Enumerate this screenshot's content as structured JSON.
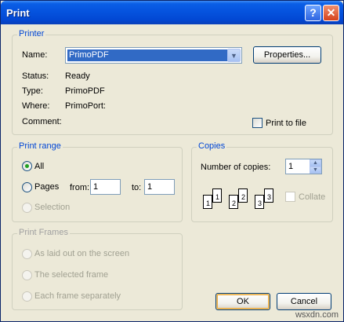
{
  "window": {
    "title": "Print",
    "help_symbol": "?",
    "close_symbol": "✕"
  },
  "printer": {
    "legend": "Printer",
    "name_label": "Name:",
    "name_value": "PrimoPDF",
    "properties_label": "Properties...",
    "status_label": "Status:",
    "status_value": "Ready",
    "type_label": "Type:",
    "type_value": "PrimoPDF",
    "where_label": "Where:",
    "where_value": "PrimoPort:",
    "comment_label": "Comment:",
    "print_to_file_label": "Print to file"
  },
  "print_range": {
    "legend": "Print range",
    "all_label": "All",
    "pages_label": "Pages",
    "from_label": "from:",
    "from_value": "1",
    "to_label": "to:",
    "to_value": "1",
    "selection_label": "Selection"
  },
  "copies": {
    "legend": "Copies",
    "number_label": "Number of copies:",
    "number_value": "1",
    "collate_label": "Collate",
    "page_numbers": [
      "1",
      "1",
      "2",
      "2",
      "3",
      "3"
    ]
  },
  "print_frames": {
    "legend": "Print Frames",
    "options": [
      "As laid out on the screen",
      "The selected frame",
      "Each frame separately"
    ]
  },
  "buttons": {
    "ok": "OK",
    "cancel": "Cancel"
  },
  "watermark": "wsxdn.com"
}
